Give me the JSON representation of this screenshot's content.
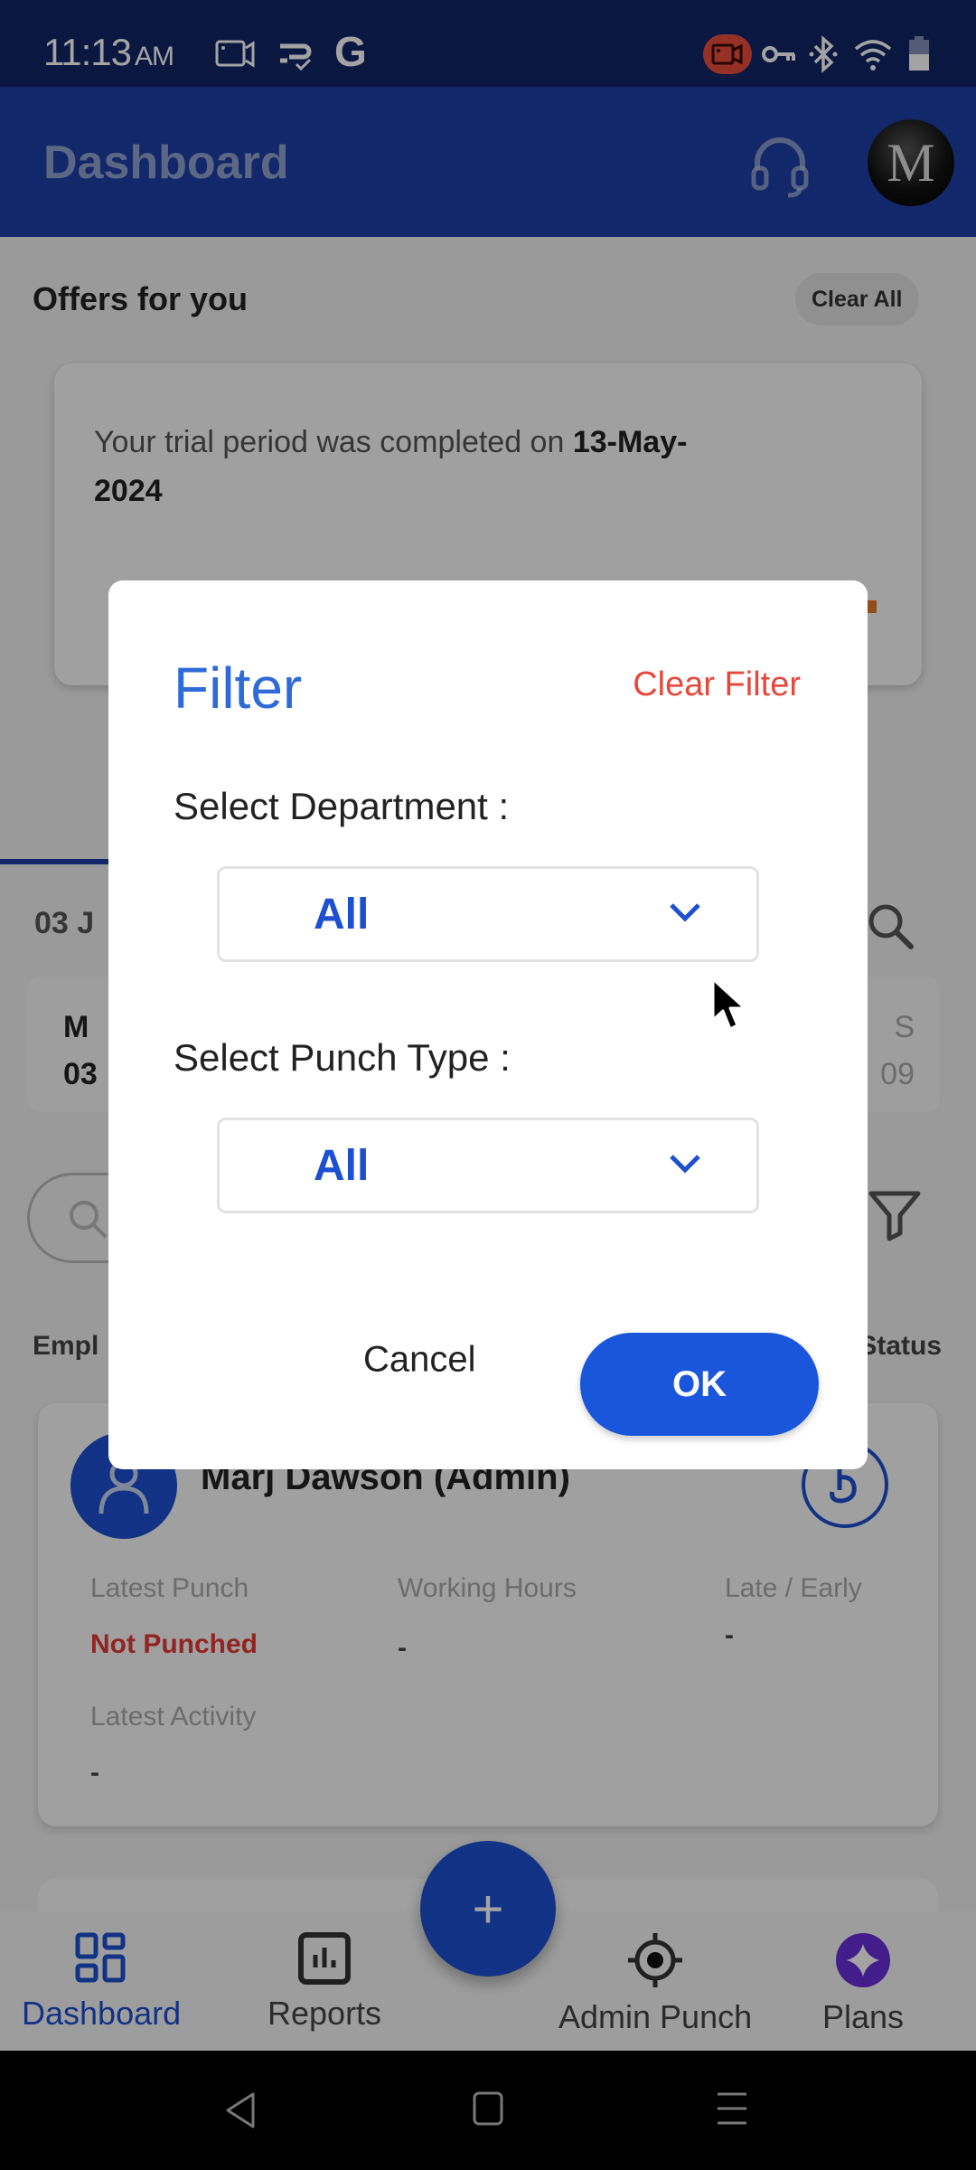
{
  "status_bar": {
    "time": "11:13",
    "ampm": "AM",
    "left_icons": [
      "screen-record-icon",
      "sync-check-icon",
      "google-icon"
    ],
    "google_glyph": "G",
    "right_icons": [
      "recording-indicator-icon",
      "vpn-key-icon",
      "bluetooth-icon",
      "wifi-icon",
      "battery-icon"
    ]
  },
  "app_bar": {
    "title": "Dashboard",
    "support_icon": "headset-icon",
    "avatar_initial": "M"
  },
  "offers": {
    "title": "Offers for you",
    "clear_all_label": "Clear All",
    "card_text_prefix": "Your trial period was completed on ",
    "card_text_date": "13-May-2024"
  },
  "dashboard": {
    "date_partial": "03 J",
    "summary_left_line1": "M",
    "summary_left_line2": "03",
    "summary_right_line1": "S",
    "summary_right_line2": "09",
    "employee_label_partial": "Empl",
    "status_label_partial": "Status",
    "employee": {
      "name": "Marj Dawson (Admin)",
      "fields": [
        {
          "label": "Latest Punch",
          "value": "Not Punched",
          "status": "error"
        },
        {
          "label": "Working Hours",
          "value": "-"
        },
        {
          "label": "Late / Early",
          "value": "-"
        },
        {
          "label": "Latest Activity",
          "value": "-"
        }
      ]
    }
  },
  "bottom_nav": {
    "items": [
      {
        "label": "Dashboard",
        "icon": "dashboard-grid-icon",
        "active": true
      },
      {
        "label": "Reports",
        "icon": "reports-chart-icon",
        "active": false
      },
      {
        "label": "Admin Punch",
        "icon": "location-target-icon",
        "active": false
      },
      {
        "label": "Plans",
        "icon": "plans-diamond-icon",
        "active": false
      }
    ],
    "fab_label": "+"
  },
  "filter_dialog": {
    "title": "Filter",
    "clear_label": "Clear Filter",
    "department_label": "Select Department :",
    "department_value": "All",
    "punch_type_label": "Select Punch Type :",
    "punch_type_value": "All",
    "cancel_label": "Cancel",
    "ok_label": "OK"
  },
  "colors": {
    "primary": "#1a56db",
    "title_blue": "#2f6ad9",
    "danger": "#e5483b",
    "app_bar": "#1d3fa8",
    "status_bar": "#0f2566",
    "plans_purple": "#6a2fd9"
  }
}
